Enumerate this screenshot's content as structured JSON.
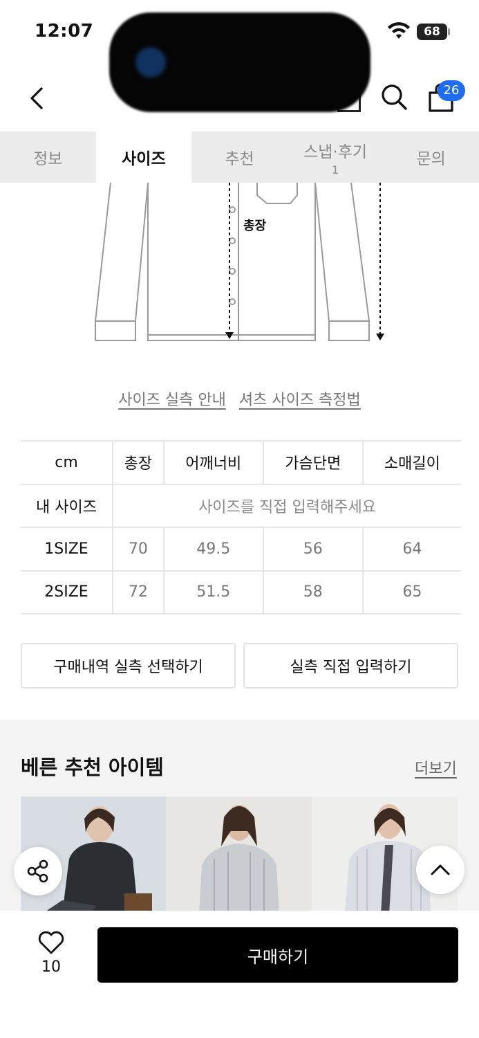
{
  "status_bar": {
    "time": "12:07",
    "battery": "68"
  },
  "header": {
    "cart_count": "26"
  },
  "tabs": [
    {
      "label": "정보",
      "count": ""
    },
    {
      "label": "사이즈",
      "count": ""
    },
    {
      "label": "추천",
      "count": ""
    },
    {
      "label": "스냅·후기",
      "count": "1"
    },
    {
      "label": "문의",
      "count": ""
    }
  ],
  "diagram": {
    "length_label": "총장"
  },
  "size_guide": {
    "link_actual": "사이즈 실측 안내",
    "link_method": "셔츠 사이즈 측정법"
  },
  "size_table": {
    "unit": "cm",
    "columns": [
      "총장",
      "어깨너비",
      "가슴단면",
      "소매길이"
    ],
    "my_size_label": "내 사이즈",
    "my_size_placeholder": "사이즈를 직접 입력해주세요",
    "rows": [
      {
        "size": "1SIZE",
        "values": [
          "70",
          "49.5",
          "56",
          "64"
        ]
      },
      {
        "size": "2SIZE",
        "values": [
          "72",
          "51.5",
          "58",
          "65"
        ]
      }
    ]
  },
  "actions": {
    "select_from_history": "구매내역 실측 선택하기",
    "enter_directly": "실측 직접 입력하기"
  },
  "recommended": {
    "title": "베른 추천 아이템",
    "more_label": "더보기"
  },
  "bottom_bar": {
    "like_count": "10",
    "buy_label": "구매하기"
  }
}
